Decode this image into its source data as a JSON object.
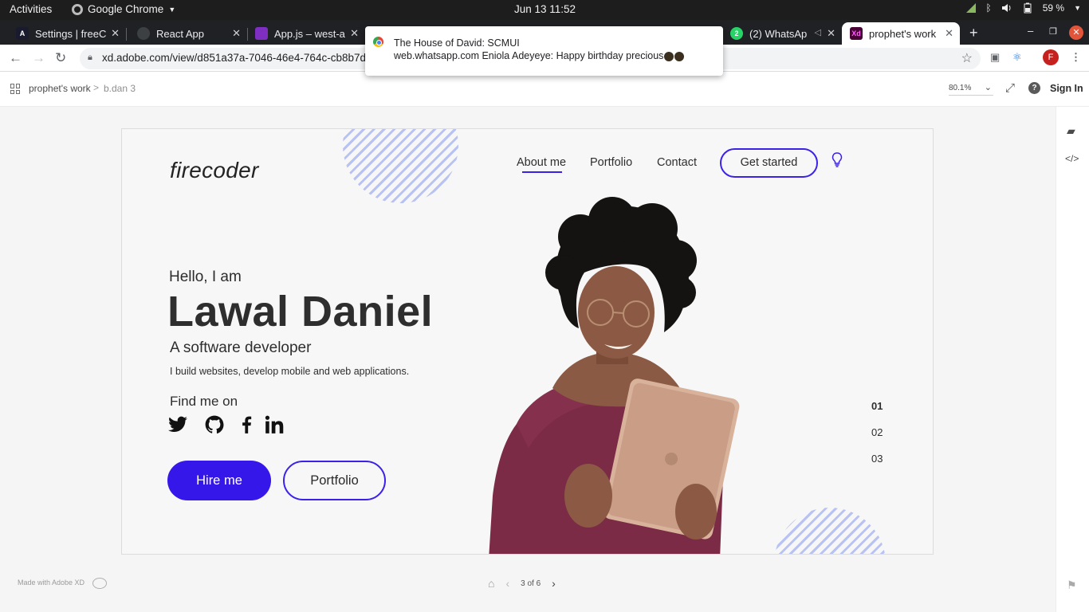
{
  "system_bar": {
    "activities": "Activities",
    "app_name": "Google Chrome",
    "datetime": "Jun 13  11:52",
    "battery": "59 %"
  },
  "tabs": [
    {
      "label": "Settings | freeC",
      "favicon": "A",
      "color": "#1a1a2e"
    },
    {
      "label": "React App",
      "favicon": "",
      "color": "#3c4043"
    },
    {
      "label": "App.js – west-a",
      "favicon": "",
      "color": "#7e2fc2"
    },
    {
      "label": "(2) WhatsAp",
      "favicon": "2",
      "color": "#25d366"
    },
    {
      "label": "prophet's work",
      "favicon": "Xd",
      "color": "#470137"
    }
  ],
  "address_bar": {
    "url": "xd.adobe.com/view/d851a37a-7046-46e4-764c-cb8b7d796"
  },
  "profile_initial": "F",
  "notification": {
    "title": "The House of David: SCMUI",
    "body": "web.whatsapp.com  Eniola Adeyeye: Happy birthday precious"
  },
  "xd_viewer": {
    "breadcrumb_project": "prophet's work",
    "breadcrumb_separator": ">",
    "breadcrumb_page": "b.dan 3",
    "zoom": "80.1%",
    "sign_in": "Sign In",
    "footer_text": "Made with Adobe XD",
    "page_indicator": "3 of 6"
  },
  "artboard": {
    "logo": "firecoder",
    "nav": {
      "about": "About me",
      "portfolio": "Portfolio",
      "contact": "Contact",
      "cta": "Get started"
    },
    "hero": {
      "greeting": "Hello, I am",
      "name": "Lawal Daniel",
      "role": "A software developer",
      "description": "I build websites, develop mobile and web applications.",
      "find_me": "Find me on"
    },
    "socials": [
      "twitter-icon",
      "github-icon",
      "facebook-icon",
      "linkedin-icon"
    ],
    "buttons": {
      "hire": "Hire me",
      "portfolio": "Portfolio"
    },
    "slides": [
      "01",
      "02",
      "03"
    ],
    "active_slide": "01",
    "accent_color": "#3617ea"
  }
}
